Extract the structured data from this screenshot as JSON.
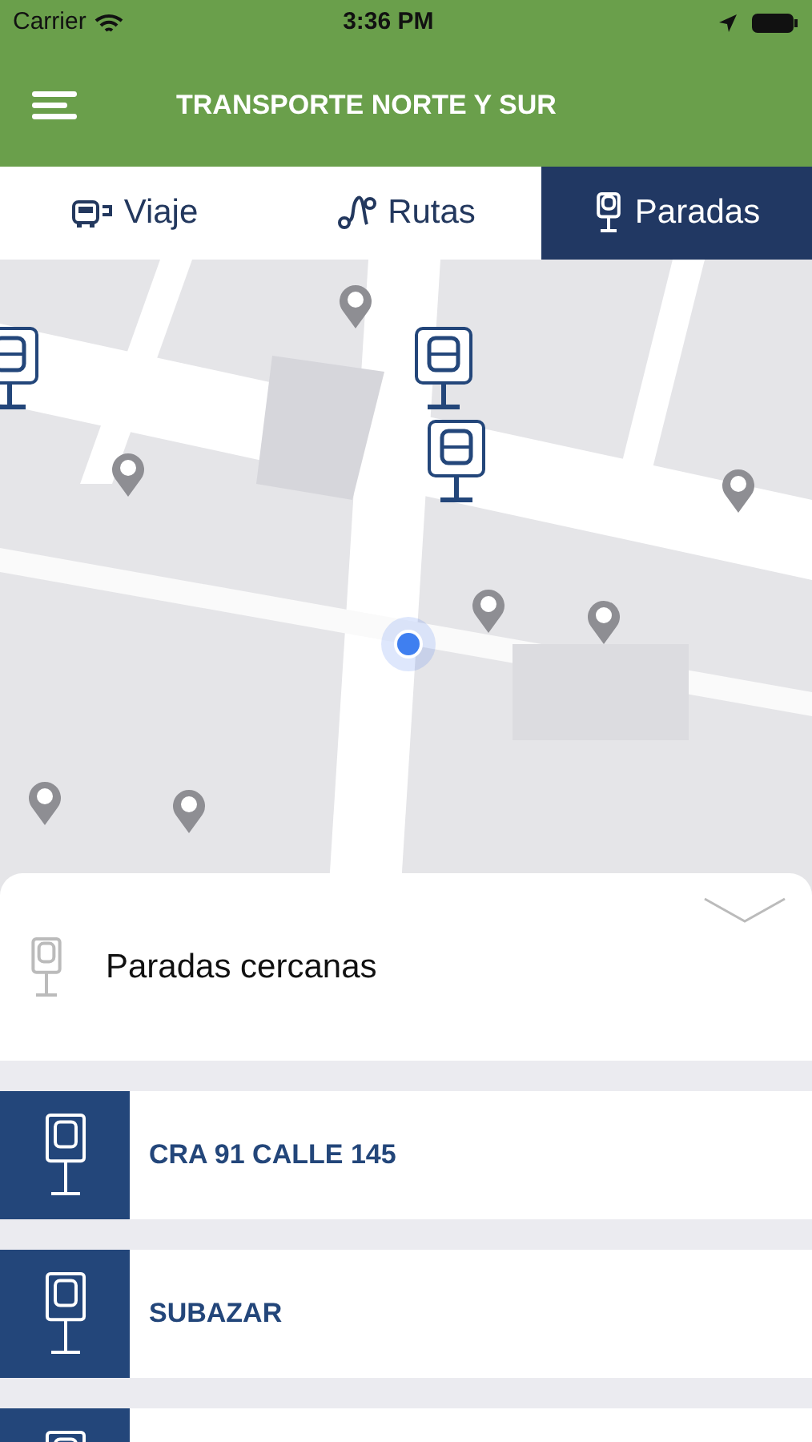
{
  "status_bar": {
    "carrier": "Carrier",
    "time": "3:36 PM"
  },
  "header": {
    "title": "TRANSPORTE NORTE Y SUR"
  },
  "tabs": [
    {
      "label": "Viaje",
      "kind": "bus",
      "selected": false
    },
    {
      "label": "Rutas",
      "kind": "route",
      "selected": false
    },
    {
      "label": "Paradas",
      "kind": "stop",
      "selected": true
    }
  ],
  "sheet": {
    "title": "Paradas cercanas",
    "expanded": true
  },
  "stops": [
    {
      "kind": "stop",
      "name": "CRA 91 CALLE 145"
    },
    {
      "kind": "stop",
      "name": "SUBAZAR"
    },
    {
      "kind": "stop"
    }
  ]
}
